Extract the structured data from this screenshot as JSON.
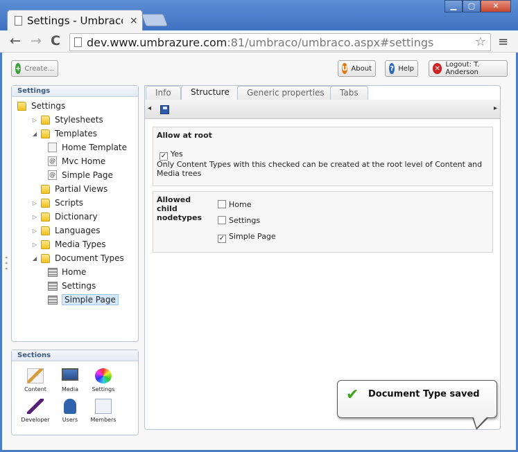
{
  "browser": {
    "tab_title": "Settings - Umbraco C",
    "tab_close": "×",
    "window_minimize": "▁",
    "window_maximize": "▢",
    "window_close": "✕",
    "back": "←",
    "forward": "→",
    "reload": "C",
    "url_host": "dev.www.umbrazure.com",
    "url_rest": ":81/umbraco/umbraco.aspx#settings",
    "star": "☆",
    "menu": "≡"
  },
  "top_buttons": {
    "create": "Create...",
    "about": "About",
    "help": "Help",
    "logout": "Logout: T. Anderson"
  },
  "settings_panel": {
    "header": "Settings",
    "tree": [
      {
        "label": "Settings",
        "type": "folder",
        "level": 0,
        "arrow": ""
      },
      {
        "label": "Stylesheets",
        "type": "folder",
        "level": 1,
        "arrow": "▷"
      },
      {
        "label": "Templates",
        "type": "folder",
        "level": 1,
        "arrow": "◢"
      },
      {
        "label": "Home Template",
        "type": "file",
        "level": 2,
        "arrow": ""
      },
      {
        "label": "Mvc Home",
        "type": "at",
        "level": 2,
        "arrow": ""
      },
      {
        "label": "Simple Page",
        "type": "at",
        "level": 2,
        "arrow": ""
      },
      {
        "label": "Partial Views",
        "type": "folder",
        "level": 1,
        "arrow": ""
      },
      {
        "label": "Scripts",
        "type": "folder",
        "level": 1,
        "arrow": "▷"
      },
      {
        "label": "Dictionary",
        "type": "folder",
        "level": 1,
        "arrow": "▷"
      },
      {
        "label": "Languages",
        "type": "folder",
        "level": 1,
        "arrow": "▷"
      },
      {
        "label": "Media Types",
        "type": "folder",
        "level": 1,
        "arrow": "▷"
      },
      {
        "label": "Document Types",
        "type": "folder",
        "level": 1,
        "arrow": "◢"
      },
      {
        "label": "Home",
        "type": "doctype",
        "level": 2,
        "arrow": ""
      },
      {
        "label": "Settings",
        "type": "doctype",
        "level": 2,
        "arrow": ""
      },
      {
        "label": "Simple Page",
        "type": "doctype",
        "level": 2,
        "arrow": "",
        "selected": true
      }
    ]
  },
  "sections_panel": {
    "header": "Sections",
    "items": [
      {
        "label": "Content",
        "icon": "pencil-icon"
      },
      {
        "label": "Media",
        "icon": "monitor-icon"
      },
      {
        "label": "Settings",
        "icon": "color-wheel-icon"
      },
      {
        "label": "Developer",
        "icon": "wand-icon"
      },
      {
        "label": "Users",
        "icon": "user-icon"
      },
      {
        "label": "Members",
        "icon": "members-icon"
      }
    ]
  },
  "content_tabs": [
    "Info",
    "Structure",
    "Generic properties",
    "Tabs"
  ],
  "active_tab": "Structure",
  "strip_arrows": {
    "left": "◂",
    "right": "▸"
  },
  "allow_root": {
    "title": "Allow at root",
    "checkbox_label": "Yes",
    "checked": true,
    "description": "Only Content Types with this checked can be created at the root level of Content and Media trees"
  },
  "allowed_child": {
    "title_lines": [
      "Allowed",
      "child",
      "nodetypes"
    ],
    "options": [
      {
        "label": "Home",
        "checked": false
      },
      {
        "label": "Settings",
        "checked": false
      },
      {
        "label": "Simple Page",
        "checked": true
      }
    ],
    "check_mark": "✓"
  },
  "notification": {
    "text": "Document Type saved",
    "check": "✔"
  },
  "colors": {
    "window_blue": "#4a7cc7",
    "panel_border": "#b8c3d1",
    "selection": "#d6e9fb"
  }
}
